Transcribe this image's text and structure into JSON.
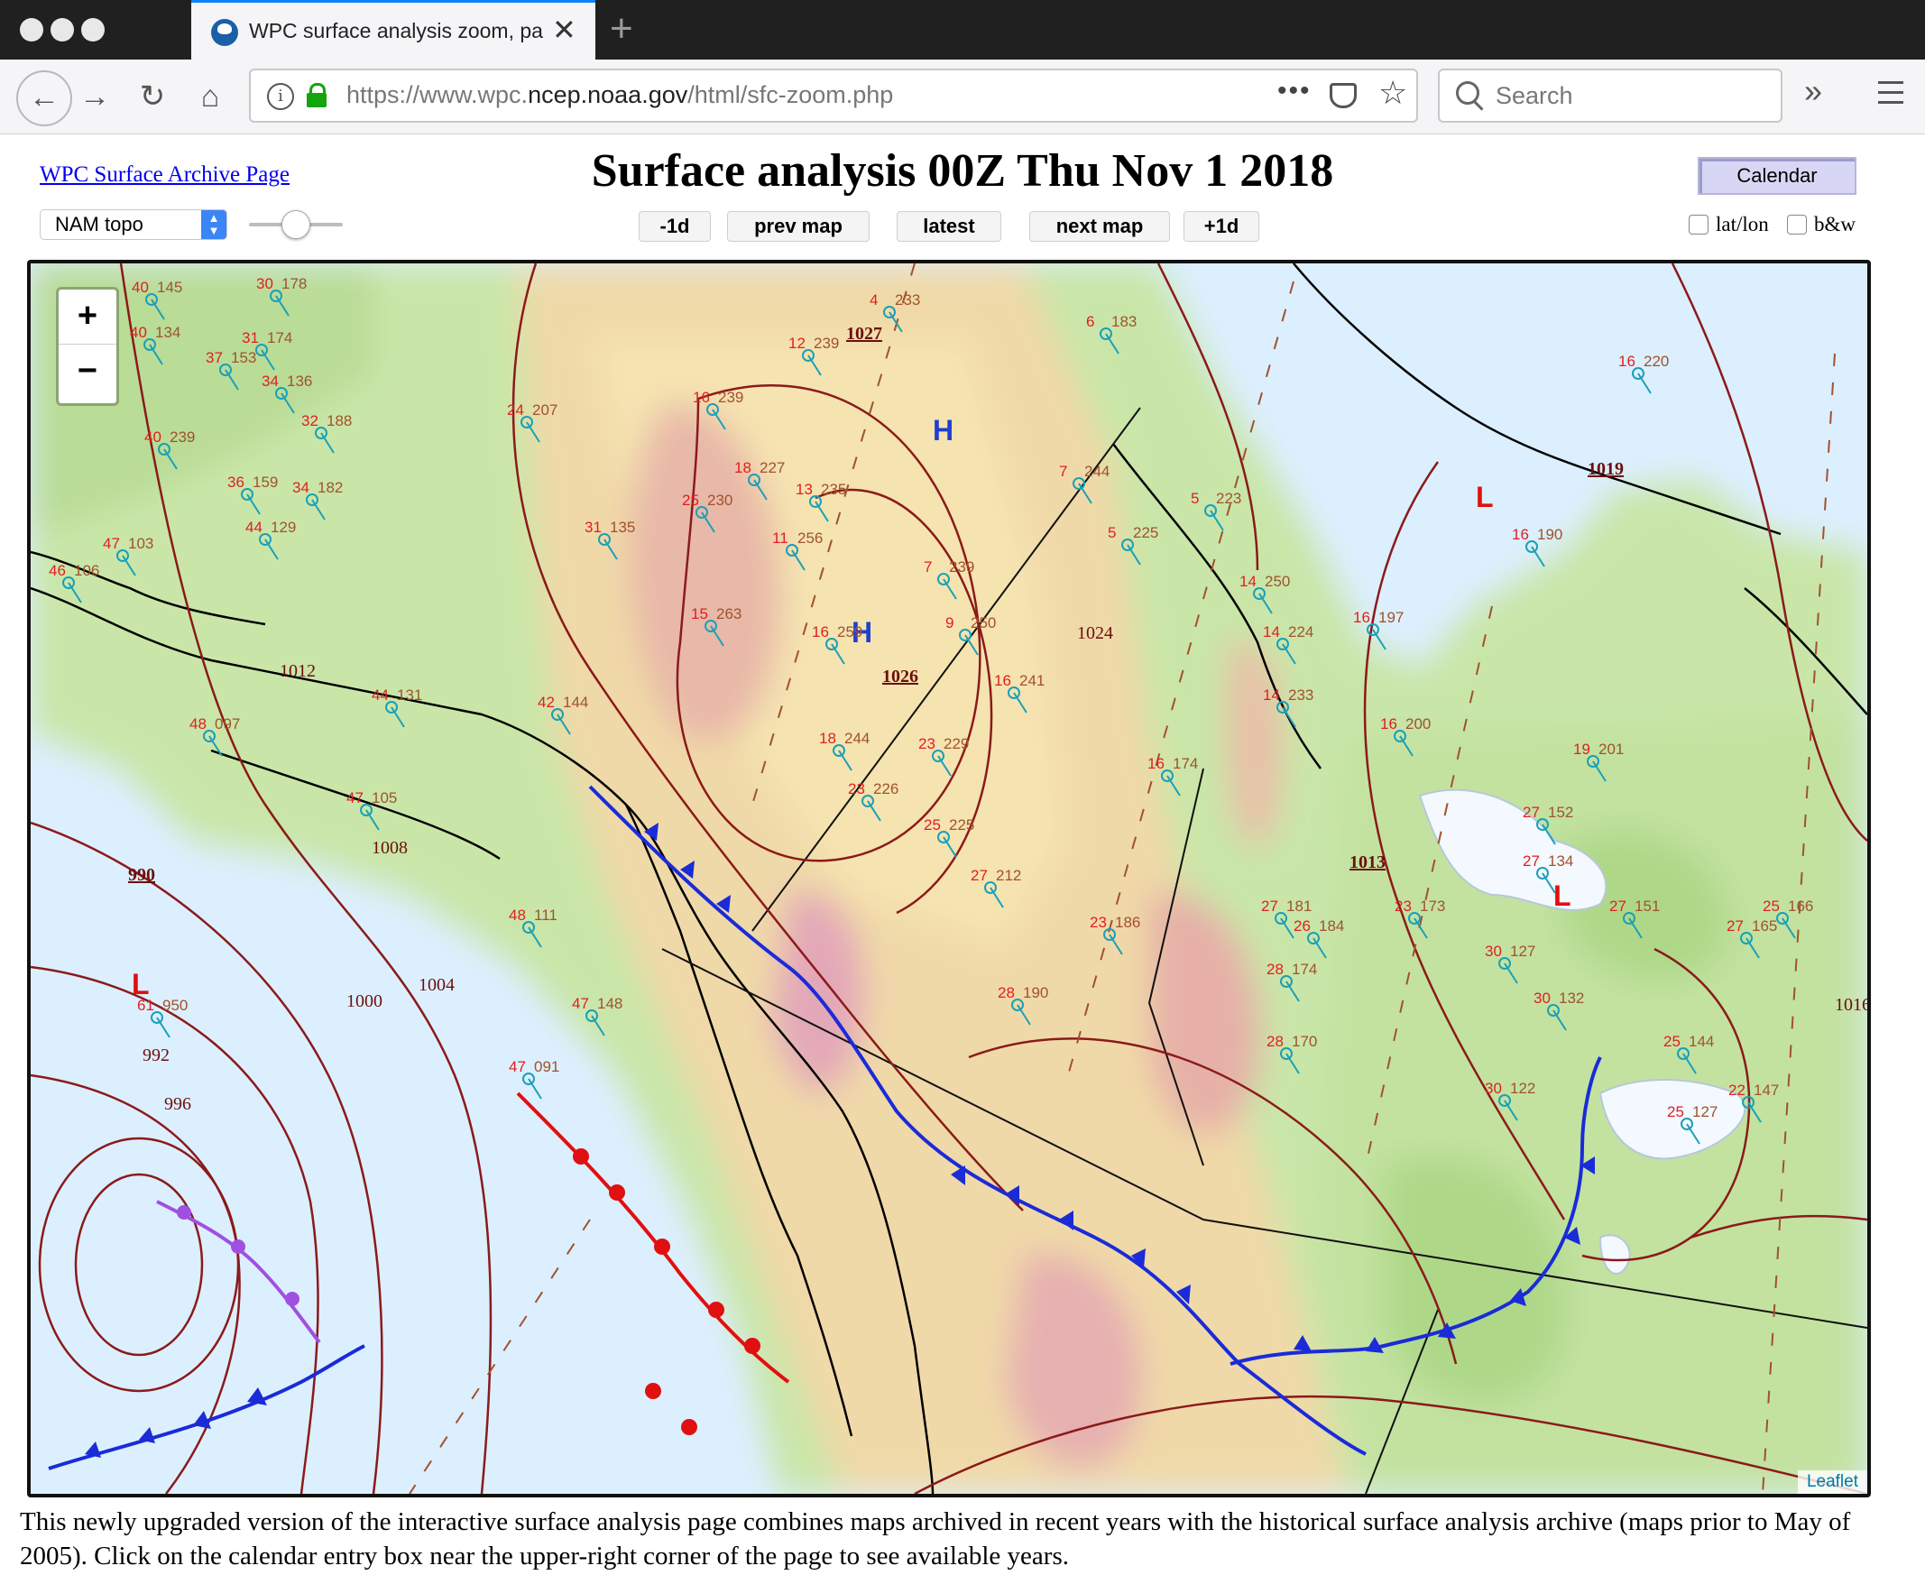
{
  "browser": {
    "tab_title": "WPC surface analysis zoom, pa",
    "url_host_prefix": "https://www.wpc.",
    "url_host": "ncep.noaa.gov",
    "url_path": "/html/sfc-zoom.php",
    "search_placeholder": "Search"
  },
  "page": {
    "archive_link": "WPC Surface Archive Page",
    "title": "Surface analysis 00Z Thu Nov 1 2018",
    "calendar_label": "Calendar",
    "map_type": "NAM topo",
    "nav": {
      "minus1d": "-1d",
      "prev": "prev map",
      "latest": "latest",
      "next": "next map",
      "plus1d": "+1d"
    },
    "checkboxes": {
      "latlon": "lat/lon",
      "bw": "b&w"
    },
    "zoom_in": "+",
    "zoom_out": "−",
    "attribution": "Leaflet",
    "footer": "This newly upgraded version of the interactive surface analysis page combines maps archived in recent years with the historical surface analysis archive (maps prior to May of 2005). Click on the calendar entry box near the upper-right corner of the page to see available years."
  },
  "map": {
    "isobars": [
      "1027",
      "1026",
      "1024",
      "1019",
      "1016",
      "1013",
      "1012",
      "1008",
      "1004",
      "1000",
      "996",
      "992",
      "990"
    ],
    "pressure_centers": [
      {
        "type": "H",
        "value": "1027"
      },
      {
        "type": "H",
        "value": "1026"
      },
      {
        "type": "L",
        "value": "990"
      },
      {
        "type": "L",
        "value": "1019"
      },
      {
        "type": "L",
        "value": "1013"
      }
    ],
    "stations": [
      "30 178",
      "40 145",
      "40 134",
      "31 174",
      "37 153",
      "34 136",
      "32 188",
      "24 207",
      "16 239",
      "12 239",
      "4 233",
      "6 183",
      "16 220",
      "40 239",
      "36 159",
      "34 182",
      "47 103",
      "46 106",
      "44 129",
      "31 135",
      "25 230",
      "13 235",
      "11 256",
      "18 227",
      "7 244",
      "5 225",
      "5 223",
      "7 239",
      "15 263",
      "16 259",
      "9 250",
      "14 250",
      "14 224",
      "16 197",
      "44 131",
      "48 097",
      "42 144",
      "18 244",
      "23 229",
      "16 241",
      "14 233",
      "16 200",
      "23 226",
      "25 225",
      "16 174",
      "47 105",
      "27 181",
      "23 173",
      "27 152",
      "27 134",
      "27 151",
      "48 111",
      "47 148",
      "28 190",
      "28 170",
      "47 091",
      "30 127",
      "30 132",
      "30 122",
      "25 144",
      "22 147",
      "25 127",
      "61 950",
      "19 201",
      "16 190",
      "26 184",
      "28 174",
      "27 165",
      "25 166",
      "23 186",
      "27 212"
    ],
    "colors": {
      "high": "#1f3fd0",
      "low": "#e01010",
      "isobar": "#8b1a1a",
      "cold_front": "#1a2bd8",
      "warm_front": "#e01010",
      "occluded_front": "#a050e0",
      "temperature": "#e02020",
      "dewpoint": "#1a9a1a",
      "pressure": "#a0522d",
      "wind": "#1aa0b8"
    }
  }
}
